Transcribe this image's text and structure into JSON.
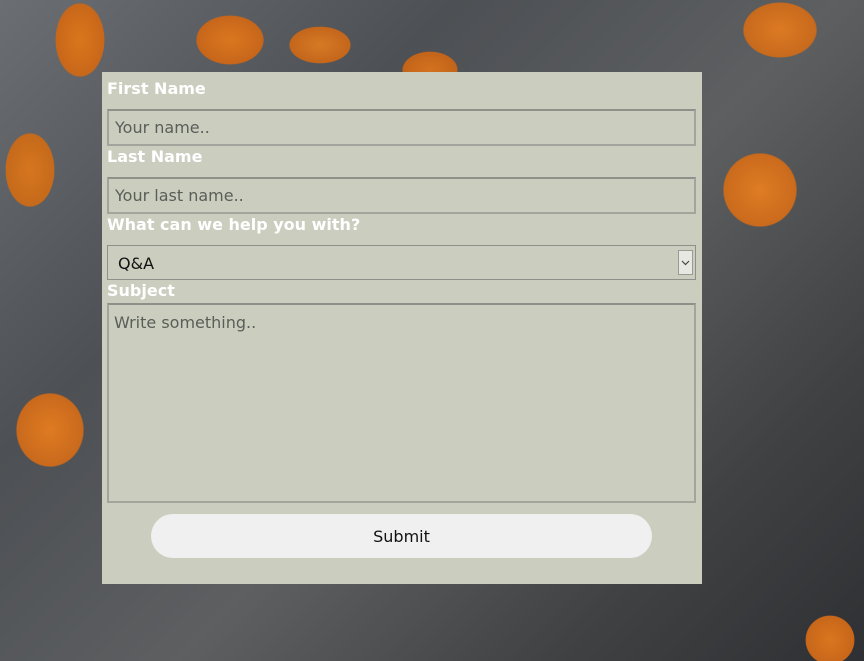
{
  "form": {
    "first_name": {
      "label": "First Name",
      "placeholder": "Your name.."
    },
    "last_name": {
      "label": "Last Name",
      "placeholder": "Your last name.."
    },
    "topic": {
      "label": "What can we help you with?",
      "selected": "Q&A"
    },
    "subject": {
      "label": "Subject",
      "placeholder": "Write something.."
    },
    "submit_label": "Submit"
  },
  "icons": {
    "select_arrow": "chevron-down-icon"
  },
  "colors": {
    "panel": "#cbcdbf",
    "label_text": "#ffffff",
    "button_bg": "#f0f0f0"
  }
}
